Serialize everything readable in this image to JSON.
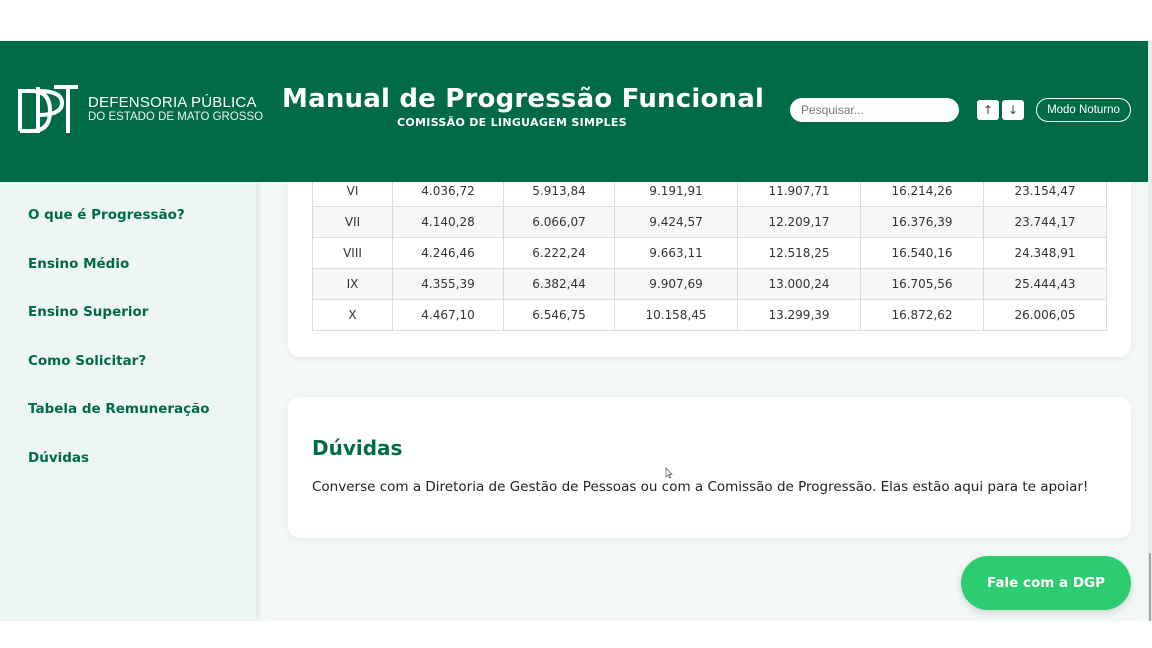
{
  "header": {
    "logo_name": "DEFENSORIA PÚBLICA",
    "logo_subtitle": "DO ESTADO DE MATO GROSSO",
    "title": "Manual de Progressão Funcional",
    "subtitle": "COMISSÃO DE LINGUAGEM SIMPLES",
    "search_placeholder": "Pesquisar...",
    "up_label": "↑",
    "down_label": "↓",
    "night_mode_label": "Modo Noturno"
  },
  "sidebar": {
    "items": [
      {
        "label": "O que é Progressão?"
      },
      {
        "label": "Ensino Médio"
      },
      {
        "label": "Ensino Superior"
      },
      {
        "label": "Como Solicitar?"
      },
      {
        "label": "Tabela de Remuneração"
      },
      {
        "label": "Dúvidas"
      }
    ]
  },
  "table": {
    "rows": [
      [
        "VI",
        "4.036,72",
        "5.913,84",
        "9.191,91",
        "11.907,71",
        "16.214,26",
        "23.154,47"
      ],
      [
        "VII",
        "4.140,28",
        "6.066,07",
        "9.424,57",
        "12.209,17",
        "16.376,39",
        "23.744,17"
      ],
      [
        "VIII",
        "4.246,46",
        "6.222,24",
        "9.663,11",
        "12.518,25",
        "16.540,16",
        "24.348,91"
      ],
      [
        "IX",
        "4.355,39",
        "6.382,44",
        "9.907,69",
        "13.000,24",
        "16.705,56",
        "25.444,43"
      ],
      [
        "X",
        "4.467,10",
        "6.546,75",
        "10.158,45",
        "13.299,39",
        "16.872,62",
        "26.006,05"
      ]
    ]
  },
  "faq": {
    "title": "Dúvidas",
    "text": "Converse com a Diretoria de Gestão de Pessoas ou com a Comissão de Progressão. Elas estão aqui para te apoiar!"
  },
  "fab": {
    "label": "Fale com a DGP"
  },
  "colors": {
    "primary": "#006b45",
    "fab": "#2ecc71",
    "sidebar_bg": "#eef6f2",
    "page_bg": "#f3f8f6"
  }
}
